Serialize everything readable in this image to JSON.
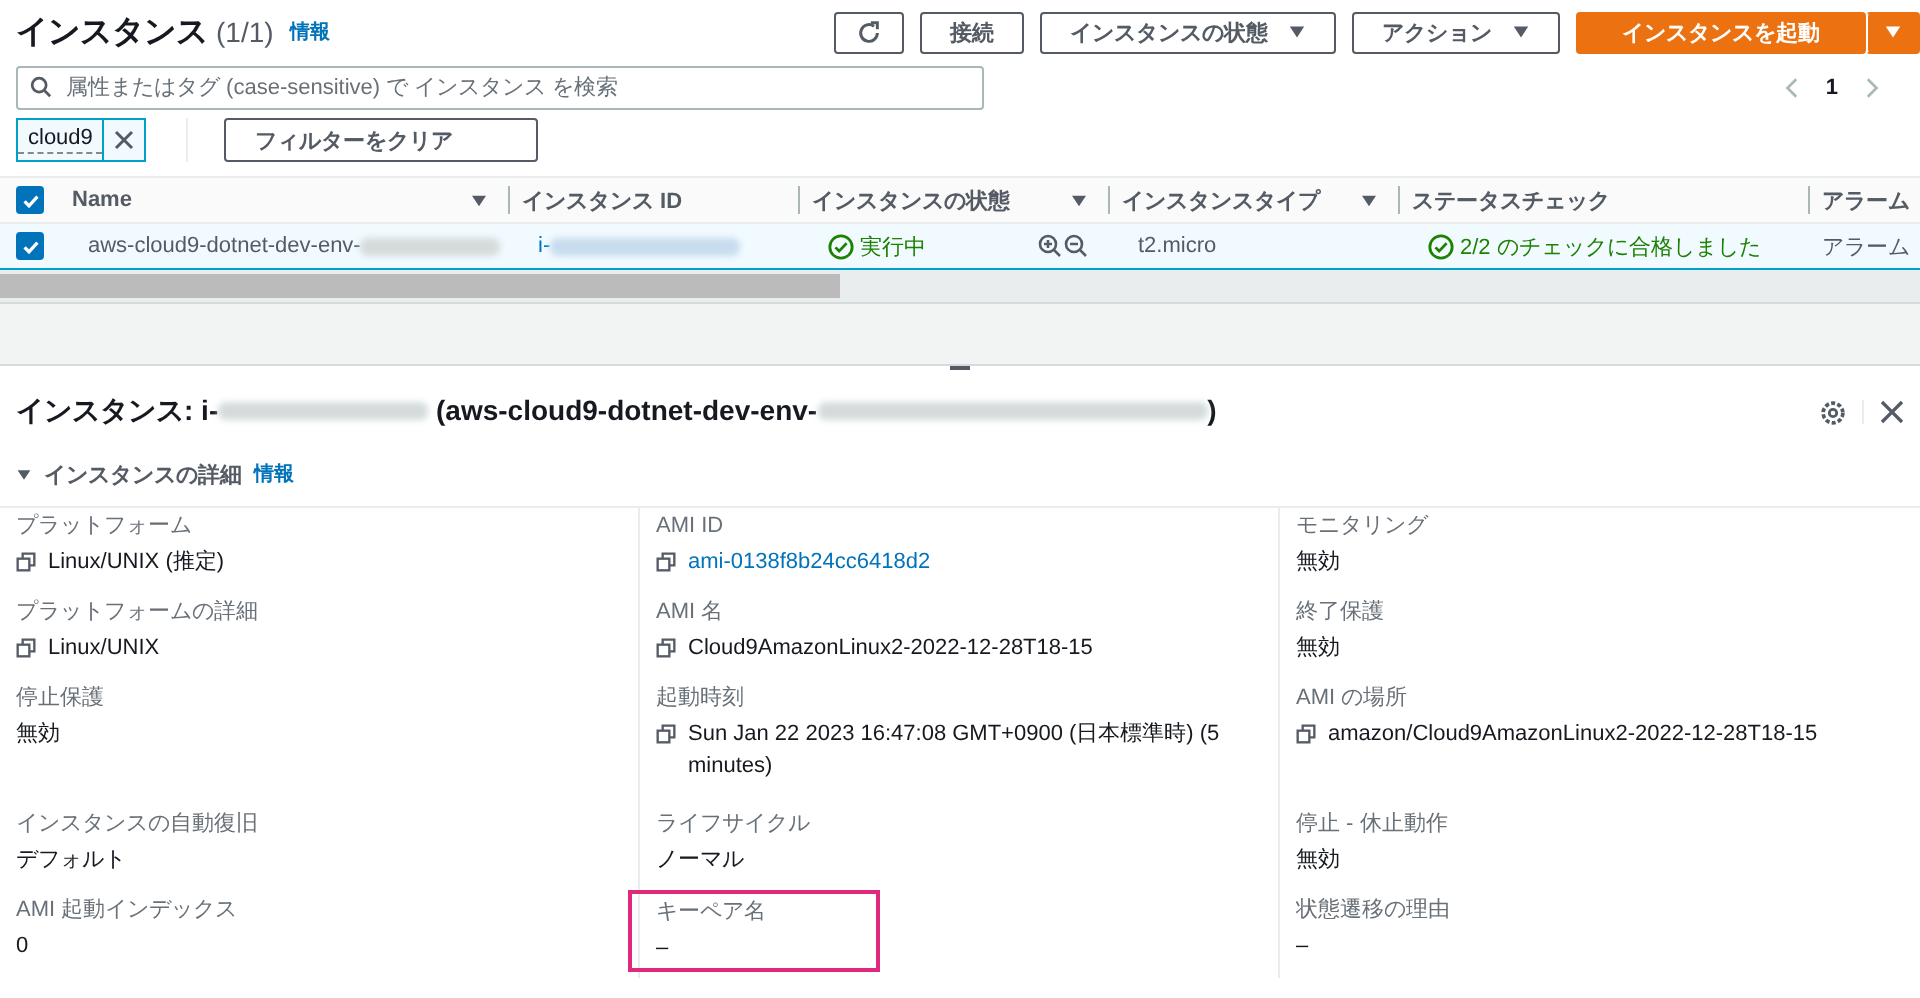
{
  "header": {
    "title": "インスタンス",
    "count": "(1/1)",
    "info": "情報"
  },
  "toolbar": {
    "buttons": [
      {
        "label": "接続",
        "kind": "plain"
      },
      {
        "label": "インスタンスの状態",
        "kind": "dropdown"
      },
      {
        "label": "アクション",
        "kind": "dropdown"
      }
    ],
    "primary": "インスタンスを起動"
  },
  "search": {
    "placeholder": "属性またはタグ (case-sensitive) で インスタンス を検索"
  },
  "pagination": {
    "page": "1"
  },
  "filters": [
    {
      "label": "cloud9"
    }
  ],
  "clear_filters": "フィルターをクリア",
  "table": {
    "all_selected": true,
    "columns": [
      {
        "label": "Name",
        "sortable": true
      },
      {
        "label": "インスタンス ID",
        "sortable": false
      },
      {
        "label": "インスタンスの状態",
        "sortable": true
      },
      {
        "label": "インスタンスタイプ",
        "sortable": true
      },
      {
        "label": "ステータスチェック",
        "sortable": false
      },
      {
        "label": "アラーム",
        "sortable": false
      }
    ],
    "rows": [
      {
        "selected": true,
        "name": "aws-cloud9-dotnet-dev-env-",
        "id": "i-",
        "state": "実行中",
        "type": "t2.micro",
        "status": "2/2 のチェックに合格しました",
        "alarm": "アラーム"
      }
    ]
  },
  "detail": {
    "title_prefix": "インスタンス: i-",
    "title_name": "(aws-cloud9-dotnet-dev-env-",
    "title_suffix": ")",
    "section": {
      "title": "インスタンスの詳細",
      "info": "情報",
      "expanded": true
    },
    "fields": [
      {
        "label": "プラットフォーム",
        "value": "Linux/UNIX (推定)",
        "copy": true,
        "link": false,
        "highlighted": false
      },
      {
        "label": "AMI ID",
        "value": "ami-0138f8b24cc6418d2",
        "copy": true,
        "link": true,
        "highlighted": false
      },
      {
        "label": "モニタリング",
        "value": "無効",
        "copy": false,
        "link": false,
        "highlighted": false
      },
      {
        "label": "プラットフォームの詳細",
        "value": "Linux/UNIX",
        "copy": true,
        "link": false,
        "highlighted": false
      },
      {
        "label": "AMI 名",
        "value": "Cloud9AmazonLinux2-2022-12-28T18-15",
        "copy": true,
        "link": false,
        "highlighted": false
      },
      {
        "label": "終了保護",
        "value": "無効",
        "copy": false,
        "link": false,
        "highlighted": false
      },
      {
        "label": "停止保護",
        "value": "無効",
        "copy": false,
        "link": false,
        "highlighted": false
      },
      {
        "label": "起動時刻",
        "value": "Sun Jan 22 2023 16:47:08 GMT+0900 (日本標準時) (5 minutes)",
        "copy": true,
        "link": false,
        "highlighted": false
      },
      {
        "label": "AMI の場所",
        "value": "amazon/Cloud9AmazonLinux2-2022-12-28T18-15",
        "copy": true,
        "link": false,
        "highlighted": false
      },
      {
        "label": "インスタンスの自動復旧",
        "value": "デフォルト",
        "copy": false,
        "link": false,
        "highlighted": false
      },
      {
        "label": "ライフサイクル",
        "value": "ノーマル",
        "copy": false,
        "link": false,
        "highlighted": false
      },
      {
        "label": "停止 - 休止動作",
        "value": "無効",
        "copy": false,
        "link": false,
        "highlighted": false
      },
      {
        "label": "AMI 起動インデックス",
        "value": "0",
        "copy": false,
        "link": false,
        "highlighted": false
      },
      {
        "label": "キーペア名",
        "value": "–",
        "copy": false,
        "link": false,
        "highlighted": true
      },
      {
        "label": "状態遷移の理由",
        "value": "–",
        "copy": false,
        "link": false,
        "highlighted": false
      }
    ]
  }
}
